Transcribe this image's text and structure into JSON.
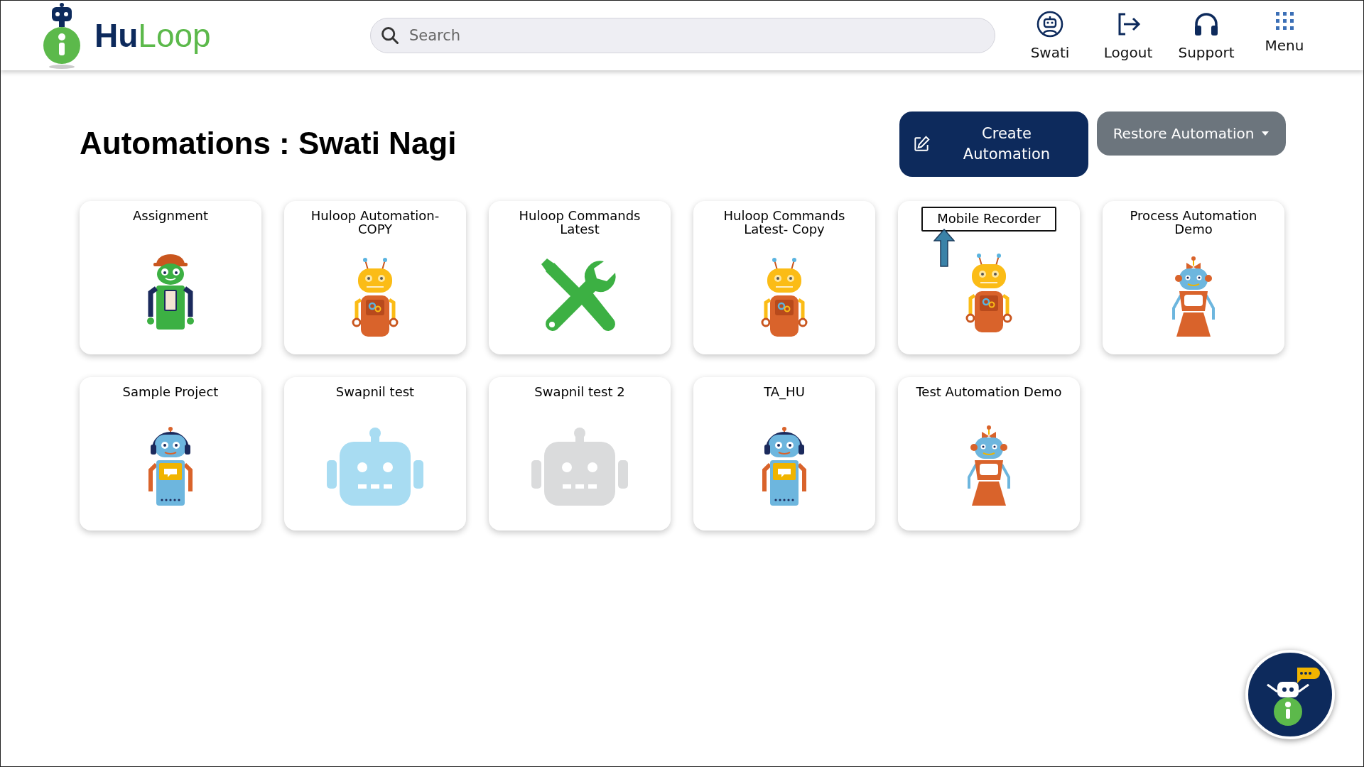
{
  "header": {
    "logo": {
      "part_1": "Hu",
      "part_2": "Loop"
    },
    "search": {
      "placeholder": "Search"
    },
    "nav": [
      {
        "kind": "user",
        "label": "Swati"
      },
      {
        "kind": "logout",
        "label": "Logout"
      },
      {
        "kind": "support",
        "label": "Support"
      },
      {
        "kind": "menu",
        "label": "Menu"
      }
    ]
  },
  "page": {
    "title": "Automations : Swati Nagi",
    "buttons": [
      {
        "kind": "create",
        "label": "Create Automation"
      },
      {
        "kind": "restore",
        "label": "Restore Automation"
      }
    ]
  },
  "automations": [
    {
      "name": "Assignment",
      "kind": "green-cap",
      "annotated": false
    },
    {
      "name": "Huloop Automation-COPY",
      "kind": "orange",
      "annotated": false
    },
    {
      "name": "Huloop Commands Latest",
      "kind": "tools",
      "annotated": false
    },
    {
      "name": "Huloop Commands Latest- Copy",
      "kind": "orange",
      "annotated": false
    },
    {
      "name": "Mobile Recorder",
      "kind": "orange",
      "annotated": true
    },
    {
      "name": "Process Automation Demo",
      "kind": "blue-dress",
      "annotated": false
    },
    {
      "name": "Sample Project",
      "kind": "headset",
      "annotated": false
    },
    {
      "name": "Swapnil test",
      "kind": "flat-blue",
      "annotated": false
    },
    {
      "name": "Swapnil test 2",
      "kind": "flat-grey",
      "annotated": false
    },
    {
      "name": "TA_HU",
      "kind": "headset",
      "annotated": false
    },
    {
      "name": "Test Automation Demo",
      "kind": "blue-dress",
      "annotated": false
    }
  ]
}
